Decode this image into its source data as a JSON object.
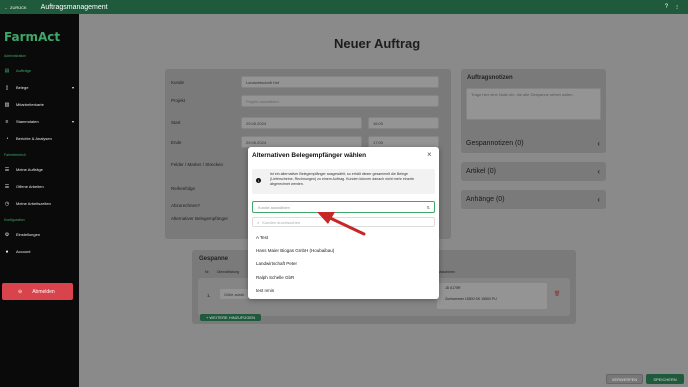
{
  "topbar": {
    "back_label": "ZURÜCK",
    "title": "Auftragsmanagement",
    "help": "?",
    "menu": "⁝"
  },
  "sidebar": {
    "logo": "FarmAct",
    "sections": {
      "admin": "Administration",
      "fahrer": "Fahrerbereich",
      "config": "Konfiguration"
    },
    "items": [
      {
        "label": "Aufträge",
        "icon": "clipboard-icon"
      },
      {
        "label": "Belege",
        "icon": "document-icon"
      },
      {
        "label": "Mitarbeiterkarte",
        "icon": "map-icon"
      },
      {
        "label": "Stammdaten",
        "icon": "database-icon"
      },
      {
        "label": "Berichte & Analysen",
        "icon": "chart-icon"
      },
      {
        "label": "Meine Aufträge",
        "icon": "tasks-icon"
      },
      {
        "label": "Offene Arbeiten",
        "icon": "tasks-icon"
      },
      {
        "label": "Meine Arbeitszeiten",
        "icon": "clock-icon"
      },
      {
        "label": "Einstellungen",
        "icon": "gear-icon"
      },
      {
        "label": "Account",
        "icon": "user-icon"
      }
    ],
    "logout": "Abmelden"
  },
  "main": {
    "title": "Neuer Auftrag",
    "form": {
      "kunde_label": "Kunde",
      "kunde_value": "Landwirtschaft Hof",
      "projekt_label": "Projekt",
      "projekt_placeholder": "Projekt auswählen",
      "start_label": "Start",
      "start_date": "29.05.2024",
      "start_time": "16:00",
      "ende_label": "Ende",
      "ende_date": "29.05.2024",
      "ende_time": "17:00",
      "felder_label": "Felder / Marker / Strecken",
      "reihenfolge_label": "Reihenfolge",
      "abzurechnen_label": "Abzurechnen?",
      "alt_label": "Alternativer Belegempfänger"
    },
    "notes": {
      "title": "Auftragsnotizen",
      "placeholder": "Trage hier eine Notiz ein, die alle Gespanne sehen sollen."
    },
    "cards": {
      "gespann": "Gespannotizen (0)",
      "artikel": "Artikel (0)",
      "anhaenge": "Anhänge (0)"
    },
    "gespanne": {
      "title": "Gespanne",
      "col_nr": "Nr.",
      "col_dienst": "Dienstleistung",
      "col_maschinen": "Maschinen",
      "row_nr": "1.",
      "row_dienst": "Gülle ausbr",
      "machine1": "JD 6175R",
      "machine2": "Zunhammer 15500 SK 15500 PU",
      "add_button": "+ WEITERE HINZUFÜGEN"
    },
    "footer": {
      "discard": "VERWERFEN",
      "save": "SPEICHERN"
    }
  },
  "modal": {
    "title": "Alternativen Belegempfänger wählen",
    "info": "Ist ein alternativer Belegempfänger ausgewählt, so erhält dieser gesammelt die Belege (Lieferscheine, Rechnungen) zu einem Auftrag. Kunden können danach nicht mehr einzeln abgerechnet werden.",
    "select_placeholder": "Kunde auswählen",
    "search_placeholder": "Kunden durchsuchen",
    "options": [
      "A Test",
      "Hans Maier Biogas GmbH (Houbaibau)",
      "Landwirtschaft Peter",
      "Ralph Schelle GbR",
      "test nmin"
    ]
  },
  "colors": {
    "brand": "#1f5a3c",
    "accent": "#3ea86b",
    "danger": "#d9434b",
    "annotation": "#c62828"
  }
}
